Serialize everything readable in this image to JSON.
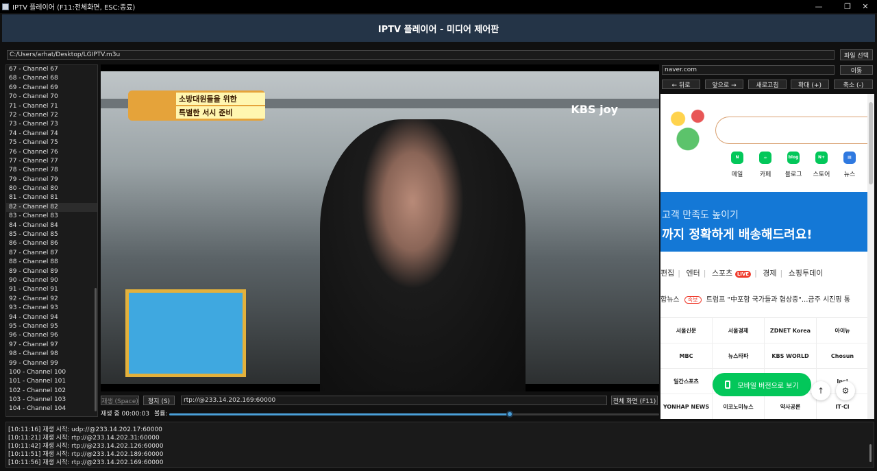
{
  "window": {
    "title": "IPTV 플레이어 (F11:전체화면, ESC:종료)",
    "minimize": "—",
    "maximize": "❐",
    "close": "✕"
  },
  "header": {
    "title": "IPTV 플레이어 - 미디어 제어판"
  },
  "file": {
    "path": "C:/Users/arhat/Desktop/LGIPTV.m3u",
    "select_label": "파일 선택"
  },
  "channels": {
    "selected_index": 15,
    "items": [
      "67 - Channel 67",
      "68 - Channel 68",
      "69 - Channel 69",
      "70 - Channel 70",
      "71 - Channel 71",
      "72 - Channel 72",
      "73 - Channel 73",
      "74 - Channel 74",
      "75 - Channel 75",
      "76 - Channel 76",
      "77 - Channel 77",
      "78 - Channel 78",
      "79 - Channel 79",
      "80 - Channel 80",
      "81 - Channel 81",
      "82 - Channel 82",
      "83 - Channel 83",
      "84 - Channel 84",
      "85 - Channel 85",
      "86 - Channel 86",
      "87 - Channel 87",
      "88 - Channel 88",
      "89 - Channel 89",
      "90 - Channel 90",
      "91 - Channel 91",
      "92 - Channel 92",
      "93 - Channel 93",
      "94 - Channel 94",
      "95 - Channel 95",
      "96 - Channel 96",
      "97 - Channel 97",
      "98 - Channel 98",
      "99 - Channel 99",
      "100 - Channel 100",
      "101 - Channel 101",
      "102 - Channel 102",
      "103 - Channel 103",
      "104 - Channel 104"
    ]
  },
  "video": {
    "logo_line1": "소방대원들을 위한",
    "logo_line2": "특별한 서시 준비",
    "broadcaster": "KBS joy"
  },
  "controls": {
    "play_label": "재생 (Space)",
    "stop_label": "정지 (S)",
    "stream_url": "rtp://@233.14.202.169:60000",
    "fullscreen_label": "전체 화면 (F11)",
    "status": "재생 중 00:00:03",
    "volume_label": "볼륨:",
    "volume_fraction": 0.695
  },
  "browser": {
    "url": "naver.com",
    "go_label": "이동",
    "back_label": "← 뒤로",
    "forward_label": "앞으로 →",
    "refresh_label": "새로고침",
    "zoom_in_label": "확대 (+)",
    "zoom_out_label": "축소 (-)",
    "services": [
      {
        "label": "메일",
        "icon": "N",
        "color": "#03c75a"
      },
      {
        "label": "카페",
        "icon": "☕",
        "color": "#03c75a"
      },
      {
        "label": "블로그",
        "icon": "blog",
        "color": "#03c75a"
      },
      {
        "label": "스토어",
        "icon": "N+",
        "color": "#03c75a"
      },
      {
        "label": "뉴스",
        "icon": "▤",
        "color": "#2f79e0"
      }
    ],
    "banner_line1": "고객 만족도 높이기",
    "banner_line2": "까지 정확하게 배송해드려요!",
    "tabs": [
      "편집",
      "엔터",
      "스포츠",
      "경제",
      "쇼핑투데이"
    ],
    "live_badge": "LIVE",
    "news_prefix": "합뉴스",
    "news_badge": "속보",
    "news_headline": "트럼프 \"中포함 국가들과 협상중\"...금주 시진핑 통",
    "press": [
      "서울신문",
      "서울경제",
      "ZDNET Korea",
      "아이뉴",
      "MBC",
      "뉴스타파",
      "KBS WORLD",
      "Chosun",
      "일간스포츠",
      "",
      "",
      "Insi",
      "YONHAP NEWS",
      "이코노미뉴스",
      "약사공론",
      "IT·CI"
    ],
    "mobile_label": "모바일 버전으로 보기",
    "top_icon": "↑",
    "settings_icon": "⚙"
  },
  "log": {
    "lines": [
      "[10:11:16] 재생 시작: udp://@233.14.202.17:60000",
      "[10:11:21] 재생 시작: rtp://@233.14.202.31:60000",
      "[10:11:42] 재생 시작: rtp://@233.14.202.126:60000",
      "[10:11:51] 재생 시작: rtp://@233.14.202.189:60000",
      "[10:11:56] 재생 시작: rtp://@233.14.202.169:60000"
    ]
  }
}
